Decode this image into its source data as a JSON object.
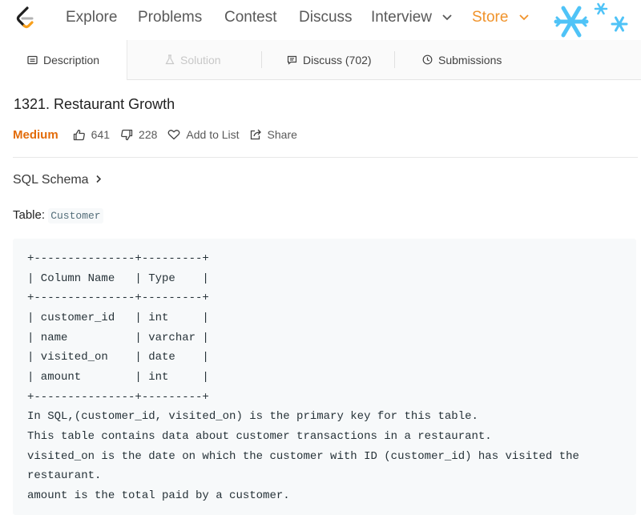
{
  "nav": {
    "items": [
      "Explore",
      "Problems",
      "Contest",
      "Discuss",
      "Interview",
      "Store"
    ]
  },
  "tabs": {
    "description": "Description",
    "solution": "Solution",
    "discuss": "Discuss (702)",
    "submissions": "Submissions"
  },
  "problem": {
    "title": "1321. Restaurant Growth",
    "difficulty": "Medium",
    "likes": "641",
    "dislikes": "228",
    "add_to_list": "Add to List",
    "share": "Share",
    "schema_link": "SQL Schema",
    "table_label": "Table: ",
    "table_name": "Customer",
    "code_lines": [
      "+---------------+---------+",
      "| Column Name   | Type    |",
      "+---------------+---------+",
      "| customer_id   | int     |",
      "| name          | varchar |",
      "| visited_on    | date    |",
      "| amount        | int     |",
      "+---------------+---------+",
      "In SQL,(customer_id, visited_on) is the primary key for this table.",
      "This table contains data about customer transactions in a restaurant.",
      "visited_on is the date on which the customer with ID (customer_id) has visited the",
      "restaurant.",
      "amount is the total paid by a customer."
    ]
  },
  "colors": {
    "medium": "#e36c0a",
    "store": "#f0932b",
    "snowflake": "#4fc3f7"
  }
}
